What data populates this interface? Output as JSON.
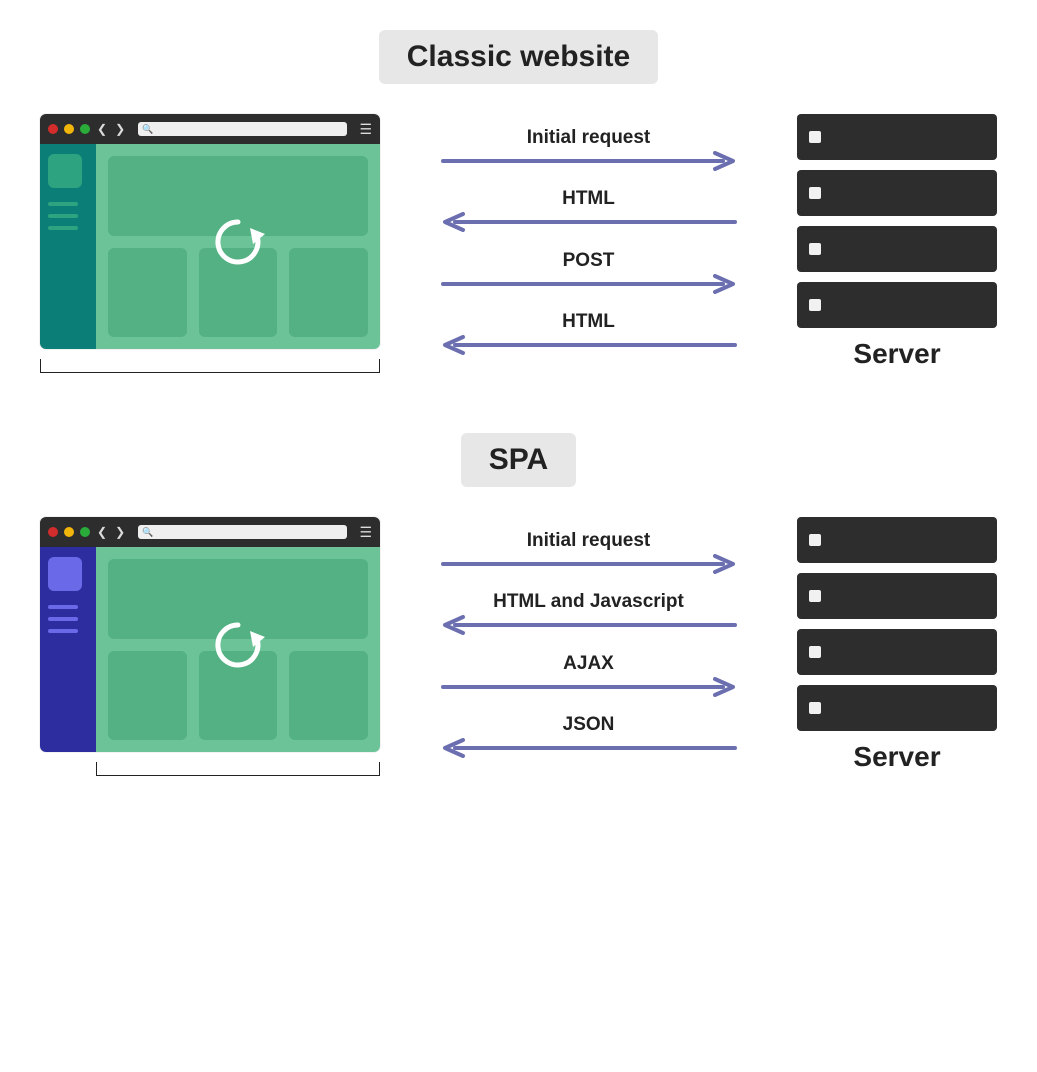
{
  "classic": {
    "title": "Classic website",
    "server_label": "Server",
    "arrows": [
      {
        "label": "Initial request",
        "dir": "right"
      },
      {
        "label": "HTML",
        "dir": "left"
      },
      {
        "label": "POST",
        "dir": "right"
      },
      {
        "label": "HTML",
        "dir": "left"
      }
    ]
  },
  "spa": {
    "title": "SPA",
    "server_label": "Server",
    "arrows": [
      {
        "label": "Initial request",
        "dir": "right"
      },
      {
        "label": "HTML and Javascript",
        "dir": "left"
      },
      {
        "label": "AJAX",
        "dir": "right"
      },
      {
        "label": "JSON",
        "dir": "left"
      }
    ]
  },
  "colors": {
    "arrow": "#6b6fb0",
    "classic_sidebar": "#0c7e78",
    "spa_sidebar": "#2e2d9f",
    "content_bg": "#6cc398",
    "card": "#54b184"
  }
}
